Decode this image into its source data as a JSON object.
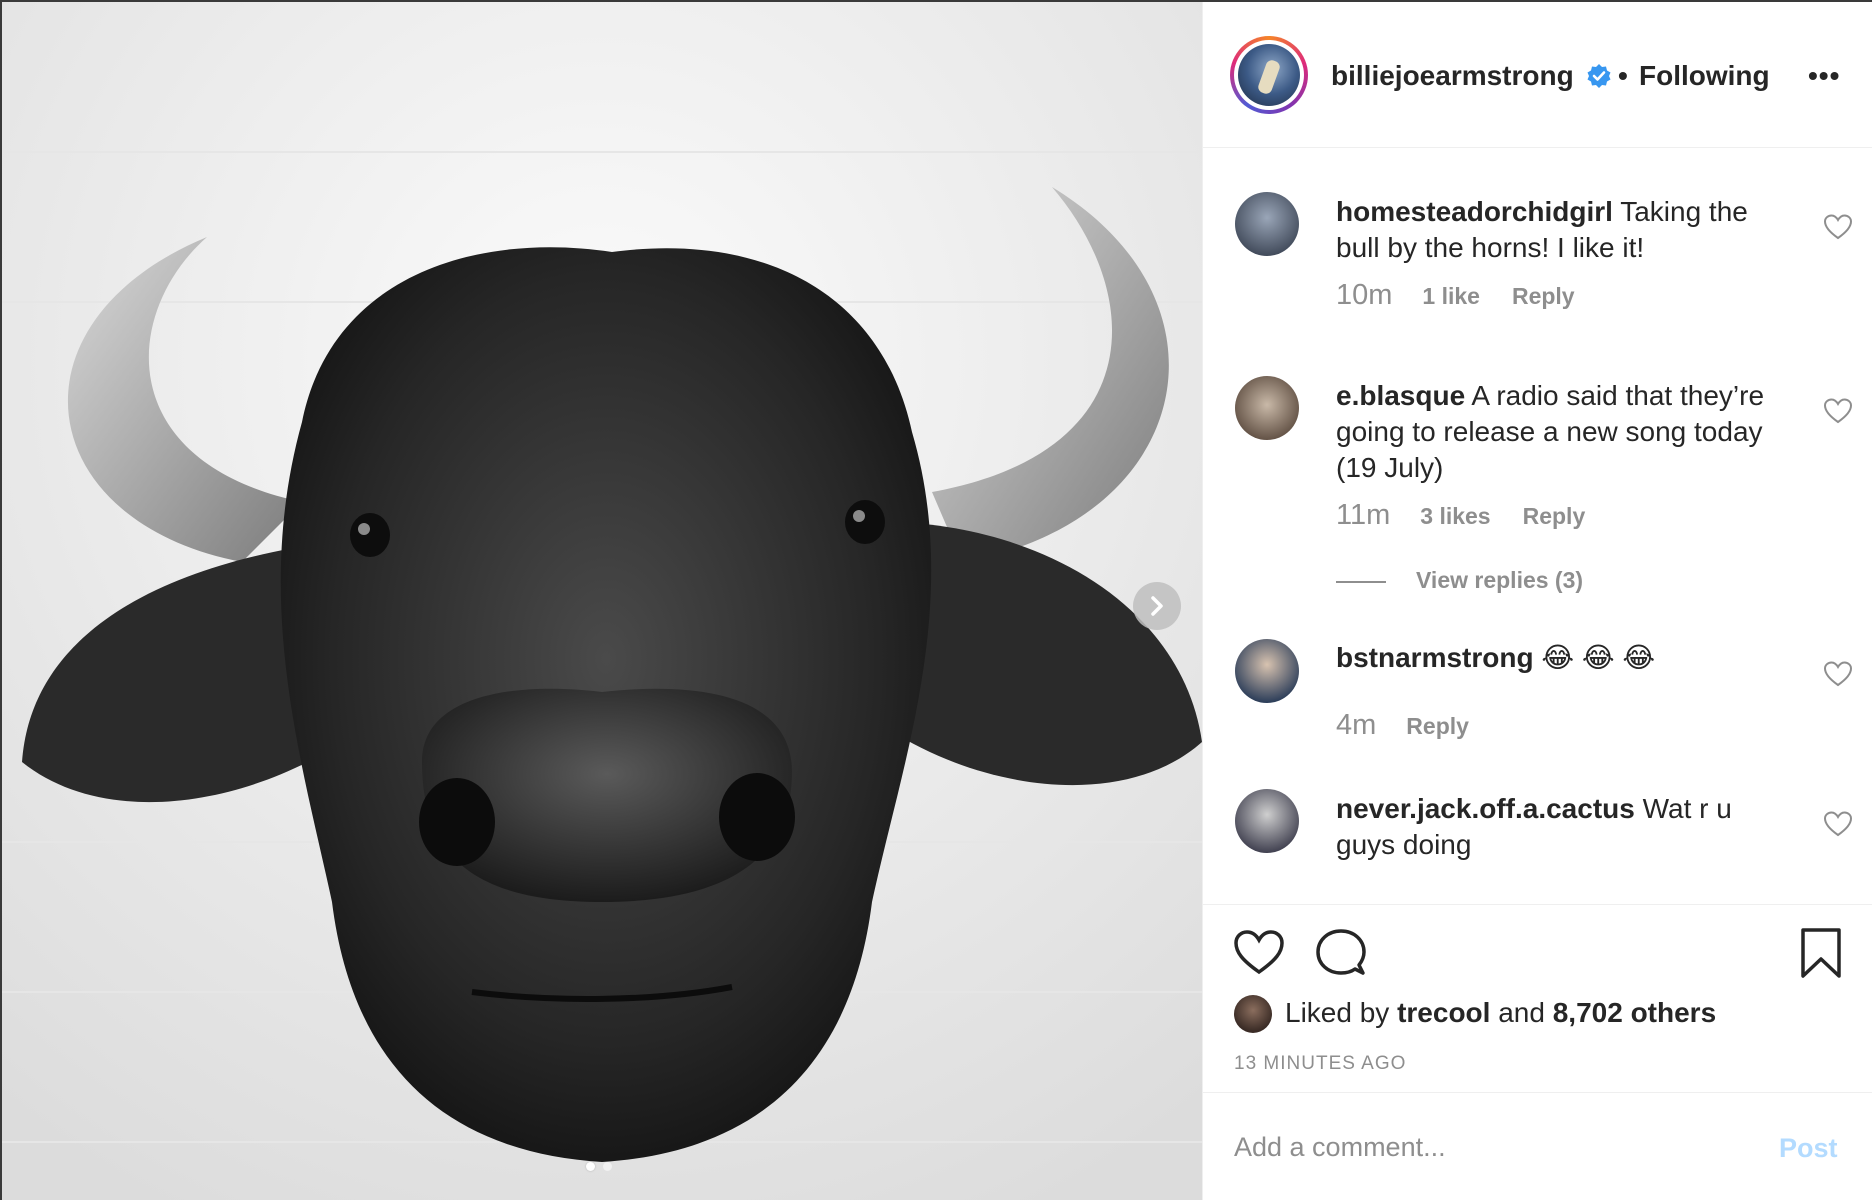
{
  "post": {
    "author": "billiejoearmstrong",
    "verified_icon": "verified-badge-icon",
    "separator": "•",
    "follow_status": "Following",
    "more_label": "•••",
    "carousel": {
      "current": 1,
      "total": 2
    }
  },
  "comments": [
    {
      "user": "homesteadorchidgirl",
      "text": "Taking the bull by the horns! I like it!",
      "time": "10m",
      "likes": "1 like",
      "reply": "Reply"
    },
    {
      "user": "e.blasque",
      "text": "A radio said that they’re going to release a new song today (19 July)",
      "time": "11m",
      "likes": "3 likes",
      "reply": "Reply",
      "view_replies": "View replies (3)"
    },
    {
      "user": "bstnarmstrong",
      "text": "😂 😂 😂",
      "time": "4m",
      "reply": "Reply"
    },
    {
      "user": "never.jack.off.a.cactus",
      "text": "Wat r u guys doing",
      "time": "",
      "reply": ""
    }
  ],
  "engagement": {
    "liked_by_prefix": "Liked by",
    "liked_by_user": "trecool",
    "liked_by_joiner": "and",
    "others": "8,702 others",
    "timestamp": "13 MINUTES AGO"
  },
  "composer": {
    "placeholder": "Add a comment...",
    "post_label": "Post",
    "post_color": "#b3dbff"
  },
  "icons": {
    "like": "heart-icon",
    "comment": "comment-icon",
    "save": "bookmark-icon",
    "next": "chevron-right-icon"
  },
  "colors": {
    "text": "#262626",
    "muted": "#8e8e8e",
    "verified": "#3897f0"
  }
}
